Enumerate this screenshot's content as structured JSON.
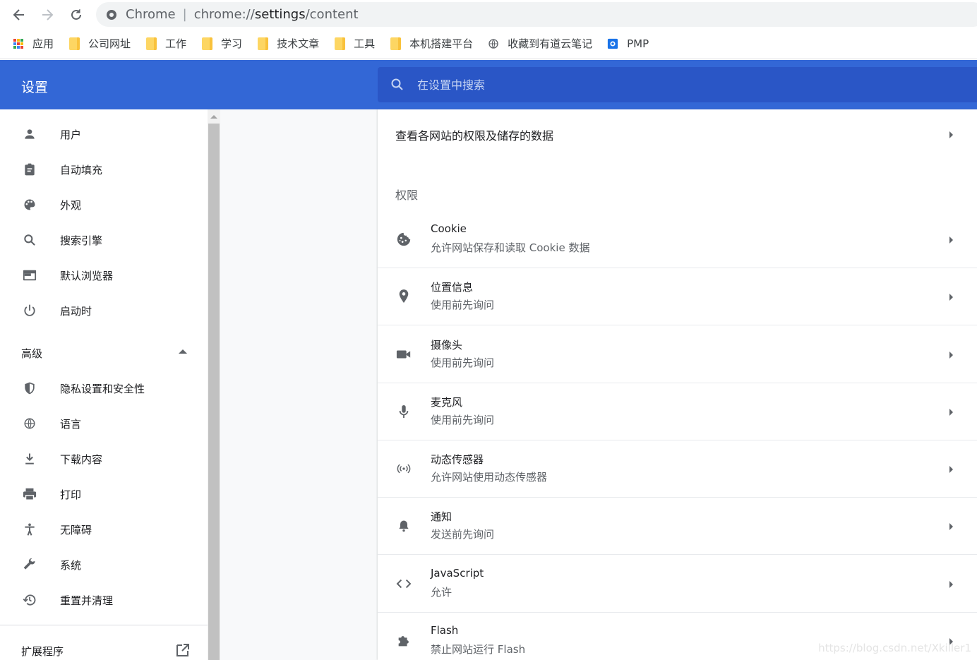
{
  "browser": {
    "name": "Chrome",
    "url_prefix": "chrome://",
    "url_path_dark": "settings",
    "url_suffix": "/content"
  },
  "bookmarks": [
    {
      "label": "应用",
      "icon": "apps-grid-icon"
    },
    {
      "label": "公司网址",
      "icon": "folder-icon"
    },
    {
      "label": "工作",
      "icon": "folder-icon"
    },
    {
      "label": "学习",
      "icon": "folder-icon"
    },
    {
      "label": "技术文章",
      "icon": "folder-icon"
    },
    {
      "label": "工具",
      "icon": "folder-icon"
    },
    {
      "label": "本机搭建平台",
      "icon": "folder-icon"
    },
    {
      "label": "收藏到有道云笔记",
      "icon": "globe-icon"
    },
    {
      "label": "PMP",
      "icon": "pmp-icon"
    }
  ],
  "header": {
    "title": "设置",
    "search_placeholder": "在设置中搜索"
  },
  "sidebar": {
    "items": [
      {
        "label": "用户",
        "icon": "person-icon"
      },
      {
        "label": "自动填充",
        "icon": "clipboard-icon"
      },
      {
        "label": "外观",
        "icon": "palette-icon"
      },
      {
        "label": "搜索引擎",
        "icon": "search-icon"
      },
      {
        "label": "默认浏览器",
        "icon": "browser-window-icon"
      },
      {
        "label": "启动时",
        "icon": "power-icon"
      }
    ],
    "advanced_label": "高级",
    "advanced_items": [
      {
        "label": "隐私设置和安全性",
        "icon": "shield-icon"
      },
      {
        "label": "语言",
        "icon": "globe-icon"
      },
      {
        "label": "下载内容",
        "icon": "download-icon"
      },
      {
        "label": "打印",
        "icon": "printer-icon"
      },
      {
        "label": "无障碍",
        "icon": "accessibility-icon"
      },
      {
        "label": "系统",
        "icon": "wrench-icon"
      },
      {
        "label": "重置并清理",
        "icon": "history-reset-icon"
      }
    ],
    "extensions_label": "扩展程序"
  },
  "content": {
    "site_data_label": "查看各网站的权限及储存的数据",
    "section_title": "权限",
    "permissions": [
      {
        "title": "Cookie",
        "subtitle": "允许网站保存和读取 Cookie 数据",
        "icon": "cookie-icon"
      },
      {
        "title": "位置信息",
        "subtitle": "使用前先询问",
        "icon": "location-pin-icon"
      },
      {
        "title": "摄像头",
        "subtitle": "使用前先询问",
        "icon": "camera-icon"
      },
      {
        "title": "麦克风",
        "subtitle": "使用前先询问",
        "icon": "microphone-icon"
      },
      {
        "title": "动态传感器",
        "subtitle": "允许网站使用动态传感器",
        "icon": "sensor-icon"
      },
      {
        "title": "通知",
        "subtitle": "发送前先询问",
        "icon": "bell-icon"
      },
      {
        "title": "JavaScript",
        "subtitle": "允许",
        "icon": "code-icon"
      },
      {
        "title": "Flash",
        "subtitle": "禁止网站运行 Flash",
        "icon": "puzzle-icon"
      }
    ]
  },
  "watermark": "https://blog.csdn.net/Xkiller1",
  "colors": {
    "header_blue": "#3367d6",
    "search_blue": "#2a56c6",
    "icon_gray": "#5f6368"
  }
}
